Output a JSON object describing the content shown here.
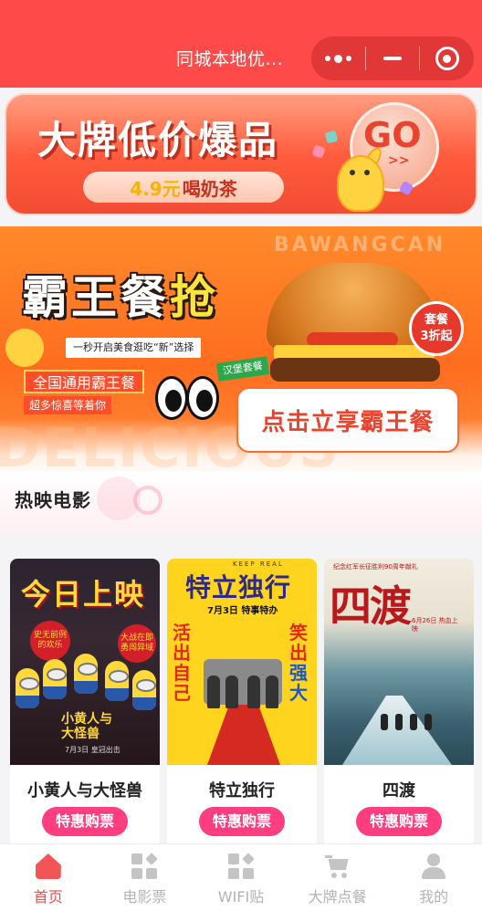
{
  "header": {
    "title": "同城本地优..."
  },
  "banner_top": {
    "title": "大牌低价爆品",
    "price": "4.9元",
    "price_suffix": "喝奶茶",
    "go_label": "GO",
    "go_arrows": ">>"
  },
  "banner_meal": {
    "title_main": "霸王餐",
    "title_accent": "抢",
    "slogan": "一秒开启美食逛吃“新”选择",
    "tag_national": "全国通用霸王餐",
    "tag_surprise": "超多惊喜等着你",
    "tag_burger": "汉堡套餐",
    "badge_line1": "套餐",
    "badge_line2": "3折起",
    "cta": "点击立享霸王餐",
    "watermark_top": "BAWANGCAN",
    "watermark_bottom": "DELICIOUS"
  },
  "section": {
    "title": "热映电影"
  },
  "movies": [
    {
      "title": "小黄人与大怪兽",
      "buy_label": "特惠购票",
      "poster_heading": "今日上映",
      "poster_badge_left": "史无前例的欢乐",
      "poster_badge_right": "大战在即勇闯异域",
      "poster_logo": "小黄人与大怪兽",
      "poster_date": "7月3日 皇冠出击"
    },
    {
      "title": "特立独行",
      "buy_label": "特惠购票",
      "poster_heading": "特立独行",
      "poster_kicker": "KEEP REAL",
      "poster_date": "7月3日 特事特办",
      "poster_left": "活出自己",
      "poster_right_a": "笑出",
      "poster_right_b": "强大"
    },
    {
      "title": "四渡",
      "buy_label": "特惠购票",
      "poster_heading": "四渡",
      "poster_top": "纪念红军长征胜利90周年献礼",
      "poster_date": "6月26日 热血上映"
    }
  ],
  "tabbar": {
    "items": [
      {
        "label": "首页",
        "icon": "home-icon",
        "active": true
      },
      {
        "label": "电影票",
        "icon": "grid-icon",
        "active": false
      },
      {
        "label": "WIFI贴",
        "icon": "grid-icon",
        "active": false
      },
      {
        "label": "大牌点餐",
        "icon": "cart-icon",
        "active": false
      },
      {
        "label": "我的",
        "icon": "user-icon",
        "active": false
      }
    ]
  },
  "colors": {
    "header_bg": "#ff4a4a",
    "buy_button": "#ff3d7f",
    "tab_active": "#f04e4e",
    "tab_inactive": "#b3b3b3"
  }
}
